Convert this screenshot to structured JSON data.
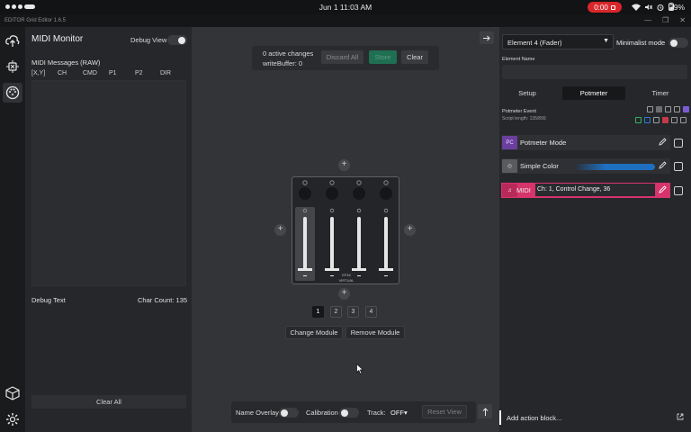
{
  "status_bar": {
    "time": "Jun 1  11:03 AM",
    "recording_time": "0:00",
    "battery": "39%",
    "icons": [
      "wifi-icon",
      "mute-icon",
      "alarm-icon",
      "battery-icon"
    ]
  },
  "title_bar": {
    "title": "EDITOR   Grid Editor 1.6.5",
    "controls": [
      "minimize",
      "maximize",
      "close"
    ]
  },
  "sidebar": {
    "icons": [
      "cloud-upload-icon",
      "debug-icon",
      "midi-monitor-icon",
      "package-icon",
      "settings-icon"
    ],
    "active": "midi-monitor-icon"
  },
  "midi_monitor": {
    "title": "MIDI Monitor",
    "debug_view_label": "Debug View",
    "debug_view_on": true,
    "messages_label": "MIDI Messages (RAW)",
    "columns": [
      "[X,Y]",
      "CH",
      "CMD",
      "P1",
      "P2",
      "DIR"
    ],
    "debug_text_label": "Debug Text",
    "char_count_label": "Char Count:",
    "char_count": "135",
    "clear_all_label": "Clear All"
  },
  "changes": {
    "active_changes": "0 active changes",
    "write_buffer": "writeBuffer: 0",
    "discard_label": "Discard All",
    "store_label": "Store",
    "clear_label": "Clear"
  },
  "module": {
    "line1": "EF44",
    "line2": "VIRTUAL",
    "pages": [
      "1",
      "2",
      "3",
      "4"
    ],
    "active_page": "1",
    "change_module_label": "Change Module",
    "remove_module_label": "Remove Module"
  },
  "bottom_bar": {
    "name_overlay_label": "Name Overlay",
    "calibration_label": "Calibration",
    "track_label": "Track:",
    "track_value": "OFF",
    "reset_view_label": "Reset View"
  },
  "config_panel": {
    "element_select": "Element 4 (Fader)",
    "minimalist_mode_label": "Minimalist mode",
    "element_name_label": "Element Name",
    "element_name_value": "",
    "tabs": [
      "Setup",
      "Potmeter",
      "Timer"
    ],
    "active_tab": "Potmeter",
    "event_title": "Potmeter Event",
    "script_length": "Script length: 135/899",
    "actions": [
      {
        "icon": "PC",
        "name": "Potmeter Mode",
        "icon_color": "#7a4bb0",
        "bg": "#2f3034"
      },
      {
        "icon": "◎",
        "name": "Simple Color",
        "icon_color": "#6a6b6e",
        "bg": "#2f3034"
      },
      {
        "icon": "♫",
        "name": "MIDI",
        "value": "Ch: 1, Control Change, 36",
        "icon_color": "#d6346b",
        "bg": "#d6346b"
      }
    ],
    "add_action_label": "Add action block..."
  },
  "colors": {
    "accent": "#d6346b",
    "store_button": "#1f6f53",
    "record": "#d9262b",
    "simple_color": "#1f6fc1"
  }
}
